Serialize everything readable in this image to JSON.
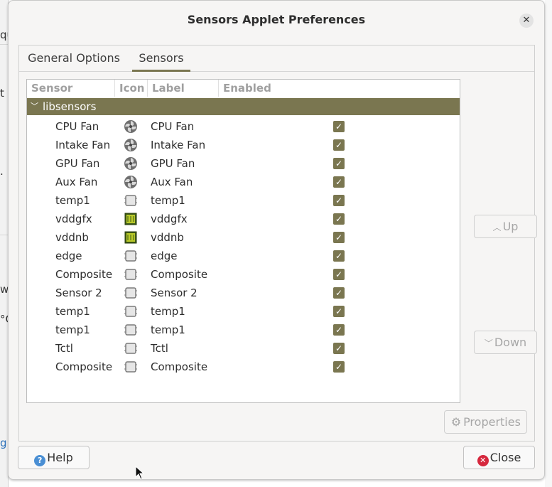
{
  "dialog": {
    "title": "Sensors Applet Preferences",
    "close_glyph": "✕"
  },
  "tabs": [
    {
      "label": "General Options",
      "active": false
    },
    {
      "label": "Sensors",
      "active": true
    }
  ],
  "columns": [
    "Sensor",
    "Icon",
    "Label",
    "Enabled"
  ],
  "group": {
    "label": "libsensors",
    "expanded": true
  },
  "sensors": [
    {
      "sensor": "CPU Fan",
      "icon": "fan-icon",
      "label": "CPU Fan",
      "enabled": true
    },
    {
      "sensor": "Intake Fan",
      "icon": "fan-icon",
      "label": "Intake Fan",
      "enabled": true
    },
    {
      "sensor": "GPU Fan",
      "icon": "fan-icon",
      "label": "GPU Fan",
      "enabled": true
    },
    {
      "sensor": "Aux Fan",
      "icon": "fan-icon",
      "label": "Aux Fan",
      "enabled": true
    },
    {
      "sensor": "temp1",
      "icon": "chip-icon",
      "label": "temp1",
      "enabled": true
    },
    {
      "sensor": "vddgfx",
      "icon": "voltage-icon",
      "label": "vddgfx",
      "enabled": true
    },
    {
      "sensor": "vddnb",
      "icon": "voltage-icon",
      "label": "vddnb",
      "enabled": true
    },
    {
      "sensor": "edge",
      "icon": "chip-icon",
      "label": "edge",
      "enabled": true
    },
    {
      "sensor": "Composite",
      "icon": "chip-icon",
      "label": "Composite",
      "enabled": true
    },
    {
      "sensor": "Sensor 2",
      "icon": "chip-icon",
      "label": "Sensor 2",
      "enabled": true
    },
    {
      "sensor": "temp1",
      "icon": "chip-icon",
      "label": "temp1",
      "enabled": true
    },
    {
      "sensor": "temp1",
      "icon": "chip-icon",
      "label": "temp1",
      "enabled": true
    },
    {
      "sensor": "Tctl",
      "icon": "chip-icon",
      "label": "Tctl",
      "enabled": true
    },
    {
      "sensor": "Composite",
      "icon": "chip-icon",
      "label": "Composite",
      "enabled": true
    }
  ],
  "buttons": {
    "up": "Up",
    "down": "Down",
    "properties": "Properties",
    "help": "Help",
    "close": "Close"
  },
  "background": {
    "fragments": [
      "qu",
      "t",
      ".",
      "ws",
      "°C",
      "g"
    ]
  },
  "colors": {
    "accent": "#7a7650",
    "close_icon": "#d6283e",
    "help_icon": "#4a8fd4"
  }
}
